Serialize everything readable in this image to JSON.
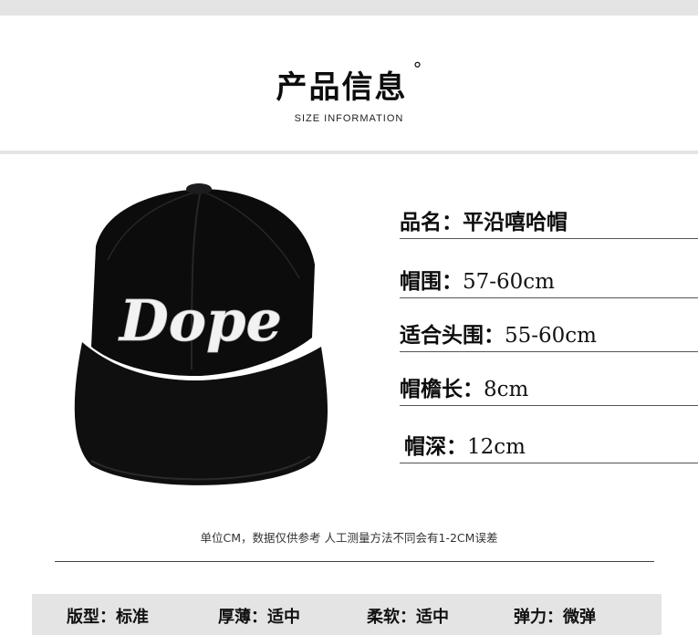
{
  "header": {
    "title": "产品信息",
    "title_mark": "°",
    "subtitle": "SIZE INFORMATION"
  },
  "product_image": {
    "logo_text": "Dope"
  },
  "specs": [
    {
      "label": "品名：",
      "value": "平沿嘻哈帽"
    },
    {
      "label": "帽围：",
      "value": "57-60cm"
    },
    {
      "label": "适合头围：",
      "value": "55-60cm"
    },
    {
      "label": "帽檐长：",
      "value": "8cm"
    },
    {
      "label": "帽深：",
      "value": "12cm"
    }
  ],
  "note": "单位CM，数据仅供参考 人工测量方法不同会有1-2CM误差",
  "attributes": [
    {
      "label": "版型：",
      "value": "标准"
    },
    {
      "label": "厚薄：",
      "value": "适中"
    },
    {
      "label": "柔软：",
      "value": "适中"
    },
    {
      "label": "弹力：",
      "value": "微弹"
    }
  ],
  "colors": {
    "band": "#e4e4e4",
    "hat_black": "#0c0c0d",
    "embroidery": "#f2f2f2"
  }
}
